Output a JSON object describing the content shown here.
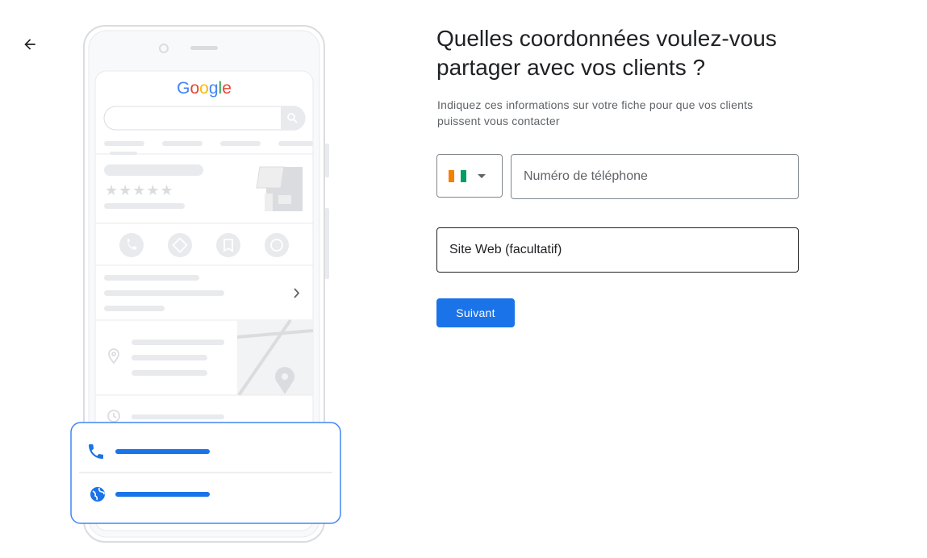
{
  "header": {
    "back_icon": "arrow-back-icon"
  },
  "illustration": {
    "logo_text": "Google",
    "logo_colors": [
      "#4285F4",
      "#EA4335",
      "#FBBC05",
      "#4285F4",
      "#34A853",
      "#EA4335"
    ],
    "rating_stars": "★★★★★",
    "card_icons": [
      "phone-icon",
      "globe-icon"
    ]
  },
  "form": {
    "title": "Quelles coordonnées voulez-vous partager avec vos clients ?",
    "subtitle": "Indiquez ces informations sur votre fiche pour que vos clients puissent vous contacter",
    "country_flag_colors": [
      "#F77F00",
      "#FFFFFF",
      "#009E60"
    ],
    "phone_placeholder": "Numéro de téléphone",
    "website_placeholder": "Site Web (facultatif)",
    "next_label": "Suivant",
    "accent_color": "#1a73e8"
  }
}
